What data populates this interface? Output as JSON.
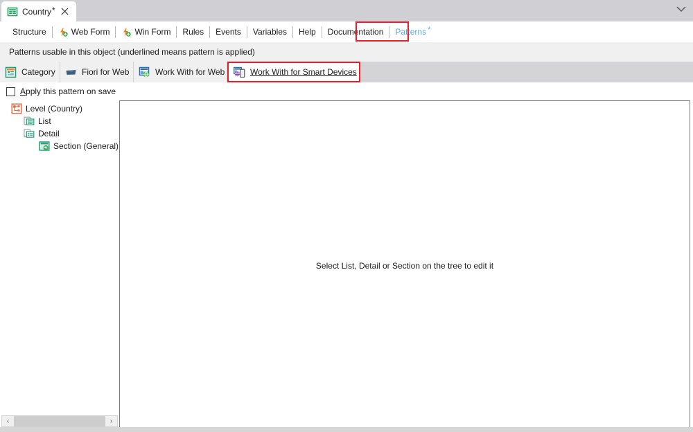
{
  "window": {
    "document_tab": {
      "icon": "transaction-object-icon",
      "label": "Country",
      "dirty_marker": "*",
      "close_icon": "close-icon"
    },
    "chevron_icon": "chevron-down-icon"
  },
  "editor_tabs": [
    {
      "label": "Structure",
      "icon": null,
      "selected": false,
      "highlighted": false
    },
    {
      "label": "Web Form",
      "icon": "bolt-add-icon",
      "selected": false,
      "highlighted": false
    },
    {
      "label": "Win Form",
      "icon": "bolt-add-icon",
      "selected": false,
      "highlighted": false
    },
    {
      "label": "Rules",
      "icon": null,
      "selected": false,
      "highlighted": false
    },
    {
      "label": "Events",
      "icon": null,
      "selected": false,
      "highlighted": false
    },
    {
      "label": "Variables",
      "icon": null,
      "selected": false,
      "highlighted": false
    },
    {
      "label": "Help",
      "icon": null,
      "selected": false,
      "highlighted": false
    },
    {
      "label": "Documentation",
      "icon": null,
      "selected": false,
      "highlighted": false
    },
    {
      "label": "Patterns",
      "icon": null,
      "selected": true,
      "highlighted": true,
      "dirty_marker": "*"
    }
  ],
  "info_bar": {
    "text": "Patterns usable in this object (underlined means pattern is applied)"
  },
  "pattern_tabs": [
    {
      "label": "Category",
      "icon": "category-pattern-icon",
      "selected": false,
      "applied": false
    },
    {
      "label": "Fiori for Web",
      "icon": "fiori-pattern-icon",
      "selected": false,
      "applied": false
    },
    {
      "label": "Work With for Web",
      "icon": "wwweb-pattern-icon",
      "selected": false,
      "applied": false
    },
    {
      "label": "Work With for Smart Devices",
      "icon": "wwsd-pattern-icon",
      "selected": true,
      "applied": true
    }
  ],
  "apply_checkbox": {
    "checked": false,
    "accel": "A",
    "label_rest": "pply this pattern on save"
  },
  "tree": [
    {
      "label": "Level (Country)",
      "icon": "level-node-icon",
      "indent": 0,
      "selected": false
    },
    {
      "label": "List",
      "icon": "list-node-icon",
      "indent": 1,
      "selected": false
    },
    {
      "label": "Detail",
      "icon": "detail-node-icon",
      "indent": 1,
      "selected": false
    },
    {
      "label": "Section (General)",
      "icon": "section-node-icon",
      "indent": 2,
      "selected": false
    }
  ],
  "tree_scrollbar": {
    "left_arrow": "‹",
    "right_arrow": "›"
  },
  "main_panel": {
    "message": "Select List, Detail or Section on the tree to edit it"
  },
  "colors": {
    "accent_tab_text": "#56a8e8",
    "annotation_red": "#ee1c25",
    "titlebar_bg": "#d0d0d4",
    "strip_bg": "#d4d4d7",
    "info_bg": "#f0f0f0",
    "panel_border": "#7a7a7a"
  }
}
